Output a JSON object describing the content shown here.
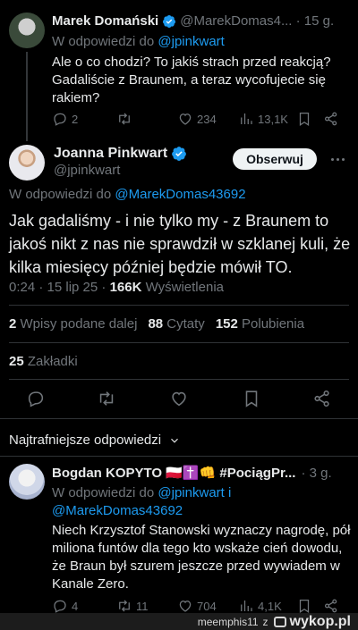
{
  "tweet1": {
    "author_name": "Marek Domański",
    "handle_time": "@MarekDomas4... · 15 g.",
    "reply_prefix": "W odpowiedzi do ",
    "reply_handle": "@jpinkwart",
    "text": "Ale o co chodzi? To jakiś strach przed reakcją? Gadaliście z Braunem, a teraz wycofujecie się rakiem?",
    "replies": "2",
    "likes": "234",
    "views": "13,1K"
  },
  "main": {
    "author_name": "Joanna Pinkwart",
    "handle": "@jpinkwart",
    "follow_label": "Obserwuj",
    "reply_prefix": "W odpowiedzi do ",
    "reply_handle": "@MarekDomas43692",
    "text": "Jak gadaliśmy - i nie tylko my - z Braunem to jakoś nikt z nas nie sprawdził w szklanej kuli, że kilka miesięcy później będzie mówił TO.",
    "time": "0:24 · 15 lip 25 · ",
    "views_count": "166K",
    "views_label": " Wyświetlenia",
    "reposts_count": "2",
    "reposts_label": " Wpisy podane dalej",
    "quotes_count": "88",
    "quotes_label": " Cytaty",
    "likes_count": "152",
    "likes_label": " Polubienia",
    "bookmarks_count": "25",
    "bookmarks_label": " Zakładki"
  },
  "sort_label": "Najtrafniejsze odpowiedzi",
  "reply": {
    "author_name": "Bogdan KOPYTO 🇵🇱✝️👊 #PociągPr...",
    "time": "· 3 g.",
    "reply_prefix": "W odpowiedzi do ",
    "reply_handle_1": "@jpinkwart",
    "reply_joiner": " i",
    "reply_handle_2": "@MarekDomas43692",
    "text": "Niech Krzysztof Stanowski wyznaczy nagrodę, pół miliona funtów dla tego kto wskaże cień dowodu, że Braun był szurem jeszcze przed wywiadem w Kanale Zero.",
    "replies": "4",
    "reposts": "11",
    "likes": "704",
    "views": "4,1K"
  },
  "watermark": {
    "user": "meemphis11",
    "joiner": "z",
    "site": "wykop.pl"
  }
}
